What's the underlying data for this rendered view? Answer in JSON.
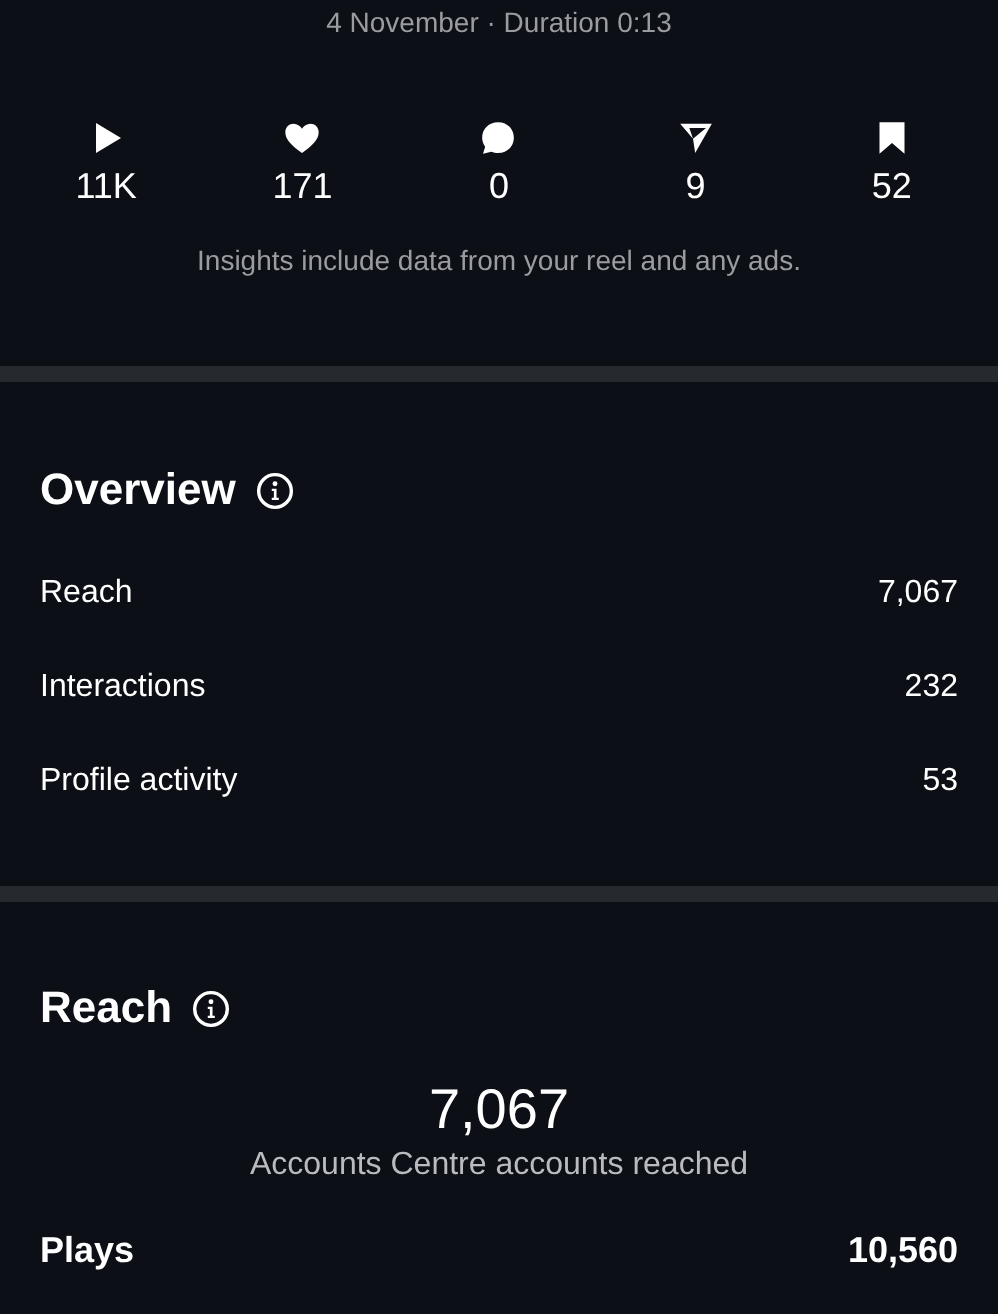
{
  "header": {
    "subtitle": "4 November · Duration 0:13"
  },
  "stats": [
    {
      "kind": "play",
      "value": "11K"
    },
    {
      "kind": "like",
      "value": "171"
    },
    {
      "kind": "comment",
      "value": "0"
    },
    {
      "kind": "share",
      "value": "9"
    },
    {
      "kind": "save",
      "value": "52"
    }
  ],
  "note": "Insights include data from your reel and any ads.",
  "overview": {
    "title": "Overview",
    "rows": [
      {
        "label": "Reach",
        "value": "7,067"
      },
      {
        "label": "Interactions",
        "value": "232"
      },
      {
        "label": "Profile activity",
        "value": "53"
      }
    ]
  },
  "reach": {
    "title": "Reach",
    "total": "7,067",
    "caption": "Accounts Centre accounts reached",
    "rows": [
      {
        "label": "Plays",
        "value": "10,560"
      }
    ]
  }
}
